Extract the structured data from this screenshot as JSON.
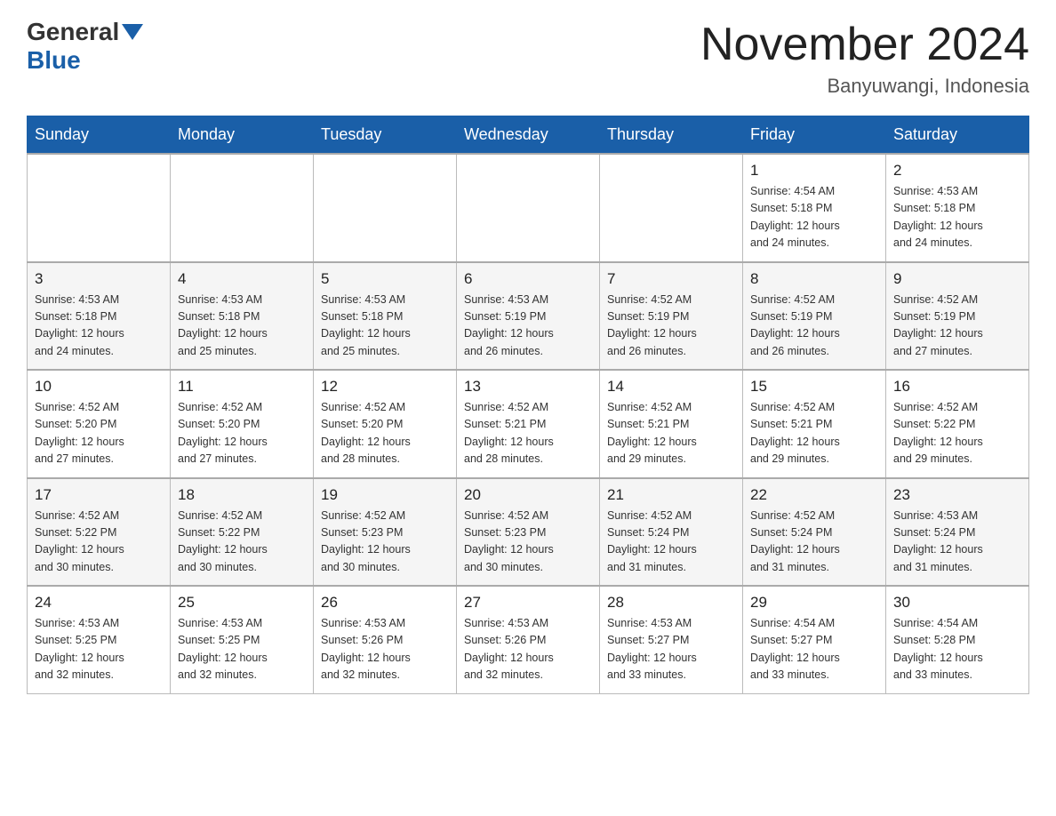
{
  "header": {
    "logo_general": "General",
    "logo_blue": "Blue",
    "month_title": "November 2024",
    "location": "Banyuwangi, Indonesia"
  },
  "weekdays": [
    "Sunday",
    "Monday",
    "Tuesday",
    "Wednesday",
    "Thursday",
    "Friday",
    "Saturday"
  ],
  "rows": [
    [
      {
        "day": "",
        "info": ""
      },
      {
        "day": "",
        "info": ""
      },
      {
        "day": "",
        "info": ""
      },
      {
        "day": "",
        "info": ""
      },
      {
        "day": "",
        "info": ""
      },
      {
        "day": "1",
        "info": "Sunrise: 4:54 AM\nSunset: 5:18 PM\nDaylight: 12 hours\nand 24 minutes."
      },
      {
        "day": "2",
        "info": "Sunrise: 4:53 AM\nSunset: 5:18 PM\nDaylight: 12 hours\nand 24 minutes."
      }
    ],
    [
      {
        "day": "3",
        "info": "Sunrise: 4:53 AM\nSunset: 5:18 PM\nDaylight: 12 hours\nand 24 minutes."
      },
      {
        "day": "4",
        "info": "Sunrise: 4:53 AM\nSunset: 5:18 PM\nDaylight: 12 hours\nand 25 minutes."
      },
      {
        "day": "5",
        "info": "Sunrise: 4:53 AM\nSunset: 5:18 PM\nDaylight: 12 hours\nand 25 minutes."
      },
      {
        "day": "6",
        "info": "Sunrise: 4:53 AM\nSunset: 5:19 PM\nDaylight: 12 hours\nand 26 minutes."
      },
      {
        "day": "7",
        "info": "Sunrise: 4:52 AM\nSunset: 5:19 PM\nDaylight: 12 hours\nand 26 minutes."
      },
      {
        "day": "8",
        "info": "Sunrise: 4:52 AM\nSunset: 5:19 PM\nDaylight: 12 hours\nand 26 minutes."
      },
      {
        "day": "9",
        "info": "Sunrise: 4:52 AM\nSunset: 5:19 PM\nDaylight: 12 hours\nand 27 minutes."
      }
    ],
    [
      {
        "day": "10",
        "info": "Sunrise: 4:52 AM\nSunset: 5:20 PM\nDaylight: 12 hours\nand 27 minutes."
      },
      {
        "day": "11",
        "info": "Sunrise: 4:52 AM\nSunset: 5:20 PM\nDaylight: 12 hours\nand 27 minutes."
      },
      {
        "day": "12",
        "info": "Sunrise: 4:52 AM\nSunset: 5:20 PM\nDaylight: 12 hours\nand 28 minutes."
      },
      {
        "day": "13",
        "info": "Sunrise: 4:52 AM\nSunset: 5:21 PM\nDaylight: 12 hours\nand 28 minutes."
      },
      {
        "day": "14",
        "info": "Sunrise: 4:52 AM\nSunset: 5:21 PM\nDaylight: 12 hours\nand 29 minutes."
      },
      {
        "day": "15",
        "info": "Sunrise: 4:52 AM\nSunset: 5:21 PM\nDaylight: 12 hours\nand 29 minutes."
      },
      {
        "day": "16",
        "info": "Sunrise: 4:52 AM\nSunset: 5:22 PM\nDaylight: 12 hours\nand 29 minutes."
      }
    ],
    [
      {
        "day": "17",
        "info": "Sunrise: 4:52 AM\nSunset: 5:22 PM\nDaylight: 12 hours\nand 30 minutes."
      },
      {
        "day": "18",
        "info": "Sunrise: 4:52 AM\nSunset: 5:22 PM\nDaylight: 12 hours\nand 30 minutes."
      },
      {
        "day": "19",
        "info": "Sunrise: 4:52 AM\nSunset: 5:23 PM\nDaylight: 12 hours\nand 30 minutes."
      },
      {
        "day": "20",
        "info": "Sunrise: 4:52 AM\nSunset: 5:23 PM\nDaylight: 12 hours\nand 30 minutes."
      },
      {
        "day": "21",
        "info": "Sunrise: 4:52 AM\nSunset: 5:24 PM\nDaylight: 12 hours\nand 31 minutes."
      },
      {
        "day": "22",
        "info": "Sunrise: 4:52 AM\nSunset: 5:24 PM\nDaylight: 12 hours\nand 31 minutes."
      },
      {
        "day": "23",
        "info": "Sunrise: 4:53 AM\nSunset: 5:24 PM\nDaylight: 12 hours\nand 31 minutes."
      }
    ],
    [
      {
        "day": "24",
        "info": "Sunrise: 4:53 AM\nSunset: 5:25 PM\nDaylight: 12 hours\nand 32 minutes."
      },
      {
        "day": "25",
        "info": "Sunrise: 4:53 AM\nSunset: 5:25 PM\nDaylight: 12 hours\nand 32 minutes."
      },
      {
        "day": "26",
        "info": "Sunrise: 4:53 AM\nSunset: 5:26 PM\nDaylight: 12 hours\nand 32 minutes."
      },
      {
        "day": "27",
        "info": "Sunrise: 4:53 AM\nSunset: 5:26 PM\nDaylight: 12 hours\nand 32 minutes."
      },
      {
        "day": "28",
        "info": "Sunrise: 4:53 AM\nSunset: 5:27 PM\nDaylight: 12 hours\nand 33 minutes."
      },
      {
        "day": "29",
        "info": "Sunrise: 4:54 AM\nSunset: 5:27 PM\nDaylight: 12 hours\nand 33 minutes."
      },
      {
        "day": "30",
        "info": "Sunrise: 4:54 AM\nSunset: 5:28 PM\nDaylight: 12 hours\nand 33 minutes."
      }
    ]
  ]
}
